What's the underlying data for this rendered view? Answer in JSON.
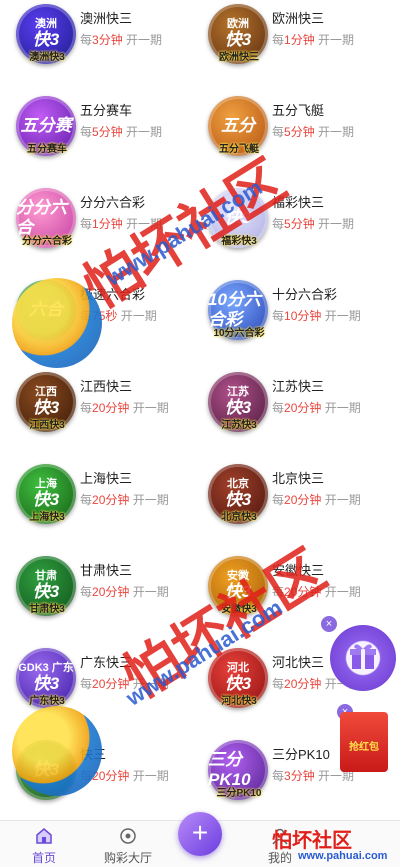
{
  "games": [
    [
      {
        "name": "澳洲快三",
        "logo_top": "澳洲",
        "logo_main": "快3",
        "caption": "澳洲快3",
        "bg": "aozhou",
        "per": "每",
        "interval": "3分钟",
        "suffix": "开一期"
      },
      {
        "name": "欧洲快三",
        "logo_top": "欧洲",
        "logo_main": "快3",
        "caption": "欧洲快三",
        "bg": "ouzhou",
        "per": "每",
        "interval": "1分钟",
        "suffix": "开一期"
      }
    ],
    [
      {
        "name": "五分赛车",
        "logo_top": "",
        "logo_main": "五分赛",
        "caption": "五分赛车",
        "bg": "wufen",
        "per": "每",
        "interval": "5分钟",
        "suffix": "开一期"
      },
      {
        "name": "五分飞艇",
        "logo_top": "",
        "logo_main": "五分",
        "caption": "五分飞艇",
        "bg": "feiting",
        "per": "每",
        "interval": "5分钟",
        "suffix": "开一期"
      }
    ],
    [
      {
        "name": "分分六合彩",
        "logo_top": "",
        "logo_main": "分分六合",
        "caption": "分分六合彩",
        "bg": "liuhe",
        "per": "每",
        "interval": "1分钟",
        "suffix": "开一期"
      },
      {
        "name": "福彩快三",
        "logo_top": "",
        "logo_main": "快3",
        "caption": "福彩快3",
        "bg": "fucai",
        "per": "每",
        "interval": "5分钟",
        "suffix": "开一期"
      }
    ],
    [
      {
        "name": "极速六合彩",
        "logo_top": "",
        "logo_main": "六合",
        "caption": "",
        "bg": "jisu",
        "per": "每",
        "interval": "75秒",
        "suffix": "开一期"
      },
      {
        "name": "十分六合彩",
        "logo_top": "",
        "logo_main": "10分六合彩",
        "caption": "10分六合彩",
        "bg": "shifen",
        "per": "每",
        "interval": "10分钟",
        "suffix": "开一期"
      }
    ],
    [
      {
        "name": "江西快三",
        "logo_top": "江西",
        "logo_main": "快3",
        "caption": "江西快3",
        "bg": "jiangxi",
        "per": "每",
        "interval": "20分钟",
        "suffix": "开一期"
      },
      {
        "name": "江苏快三",
        "logo_top": "江苏",
        "logo_main": "快3",
        "caption": "江苏快3",
        "bg": "jiangsu",
        "per": "每",
        "interval": "20分钟",
        "suffix": "开一期"
      }
    ],
    [
      {
        "name": "上海快三",
        "logo_top": "上海",
        "logo_main": "快3",
        "caption": "上海快3",
        "bg": "shanghai",
        "per": "每",
        "interval": "20分钟",
        "suffix": "开一期"
      },
      {
        "name": "北京快三",
        "logo_top": "北京",
        "logo_main": "快3",
        "caption": "北京快3",
        "bg": "beijing",
        "per": "每",
        "interval": "20分钟",
        "suffix": "开一期"
      }
    ],
    [
      {
        "name": "甘肃快三",
        "logo_top": "甘肃",
        "logo_main": "快3",
        "caption": "甘肃快3",
        "bg": "gansu",
        "per": "每",
        "interval": "20分钟",
        "suffix": "开一期"
      },
      {
        "name": "安徽快三",
        "logo_top": "安徽",
        "logo_main": "快3",
        "caption": "安徽快3",
        "bg": "anhui",
        "per": "每",
        "interval": "20分钟",
        "suffix": "开一期"
      }
    ],
    [
      {
        "name": "广东快三",
        "logo_top": "GDK3 广东",
        "logo_main": "快3",
        "caption": "广东快3",
        "bg": "guangdong",
        "per": "每",
        "interval": "20分钟",
        "suffix": "开一期"
      },
      {
        "name": "河北快三",
        "logo_top": "河北",
        "logo_main": "快3",
        "caption": "河北快3",
        "bg": "hebei",
        "per": "每",
        "interval": "20分钟",
        "suffix": "开一期"
      }
    ],
    [
      {
        "name": "快三",
        "logo_top": "",
        "logo_main": "快3",
        "caption": "",
        "bg": "hubei",
        "per": "每",
        "interval": "20分钟",
        "suffix": "开一期"
      },
      {
        "name": "三分PK10",
        "logo_top": "",
        "logo_main": "三分PK10",
        "caption": "三分PK10",
        "bg": "pk10",
        "per": "每",
        "interval": "3分钟",
        "suffix": "开一期"
      }
    ]
  ],
  "tabbar": {
    "home": "首页",
    "hall": "购彩大厅",
    "plus": "+",
    "mine": "我的"
  },
  "floating": {
    "close": "×",
    "redpacket": "抢红包"
  },
  "watermark": {
    "text": "怕坏社区",
    "url": "www.pahuai.com",
    "corner_text": "怕坏社区",
    "corner_url": "www.pahuai.com"
  }
}
